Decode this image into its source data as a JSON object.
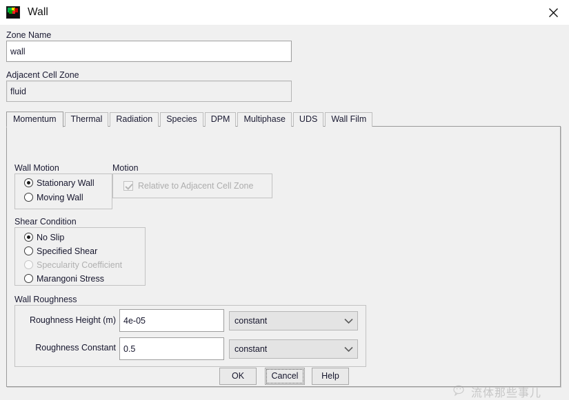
{
  "window": {
    "title": "Wall",
    "icon": "fluent-app-icon",
    "close_label": "✕"
  },
  "form": {
    "zone_name_label": "Zone Name",
    "zone_name_value": "wall",
    "adjacent_cell_zone_label": "Adjacent Cell Zone",
    "adjacent_cell_zone_value": "fluid"
  },
  "tabs": [
    {
      "label": "Momentum",
      "active": true
    },
    {
      "label": "Thermal",
      "active": false
    },
    {
      "label": "Radiation",
      "active": false
    },
    {
      "label": "Species",
      "active": false
    },
    {
      "label": "DPM",
      "active": false
    },
    {
      "label": "Multiphase",
      "active": false
    },
    {
      "label": "UDS",
      "active": false
    },
    {
      "label": "Wall Film",
      "active": false
    }
  ],
  "momentum": {
    "wall_motion": {
      "title": "Wall Motion",
      "options": [
        {
          "label": "Stationary Wall",
          "selected": true,
          "disabled": false
        },
        {
          "label": "Moving Wall",
          "selected": false,
          "disabled": false
        }
      ]
    },
    "motion": {
      "title": "Motion",
      "checkbox_label": "Relative to Adjacent Cell Zone",
      "checkbox_checked": true,
      "checkbox_disabled": true
    },
    "shear_condition": {
      "title": "Shear Condition",
      "options": [
        {
          "label": "No Slip",
          "selected": true,
          "disabled": false
        },
        {
          "label": "Specified Shear",
          "selected": false,
          "disabled": false
        },
        {
          "label": "Specularity Coefficient",
          "selected": false,
          "disabled": true
        },
        {
          "label": "Marangoni Stress",
          "selected": false,
          "disabled": false
        }
      ]
    },
    "wall_roughness": {
      "title": "Wall Roughness",
      "rows": [
        {
          "label": "Roughness Height (m)",
          "value": "4e-05",
          "method": "constant"
        },
        {
          "label": "Roughness Constant",
          "value": "0.5",
          "method": "constant"
        }
      ]
    }
  },
  "footer": {
    "ok_label": "OK",
    "cancel_label": "Cancel",
    "help_label": "Help"
  },
  "watermark": {
    "text": "流体那些事儿",
    "icon": "wechat-icon"
  }
}
